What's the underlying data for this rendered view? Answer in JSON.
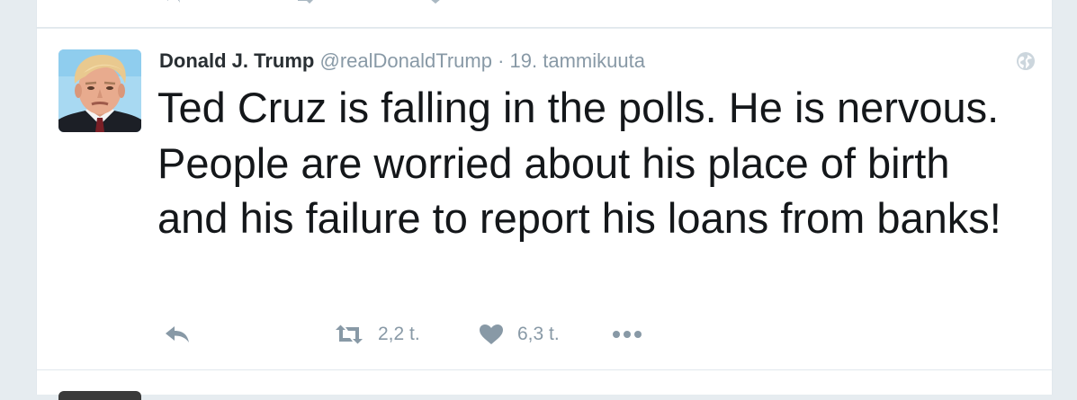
{
  "tweet": {
    "author_name": "Donald J. Trump",
    "username": "@realDonaldTrump",
    "separator": "·",
    "timestamp": "19. tammikuuta",
    "text": "Ted Cruz is falling in the polls. He is nervous. People are worried about his place of birth and his failure to report his loans from banks!",
    "avatar_icon": "profile-photo",
    "privacy_icon": "globe-icon"
  },
  "actions": {
    "reply_icon": "reply-icon",
    "retweet_icon": "retweet-icon",
    "retweet_count": "2,2 t.",
    "like_icon": "heart-icon",
    "like_count": "6,3 t.",
    "more_icon": "more-icon"
  },
  "colors": {
    "background": "#e6ecf0",
    "card": "#ffffff",
    "text": "#14171a",
    "muted": "#8899a6",
    "icon": "#aab8c2"
  }
}
